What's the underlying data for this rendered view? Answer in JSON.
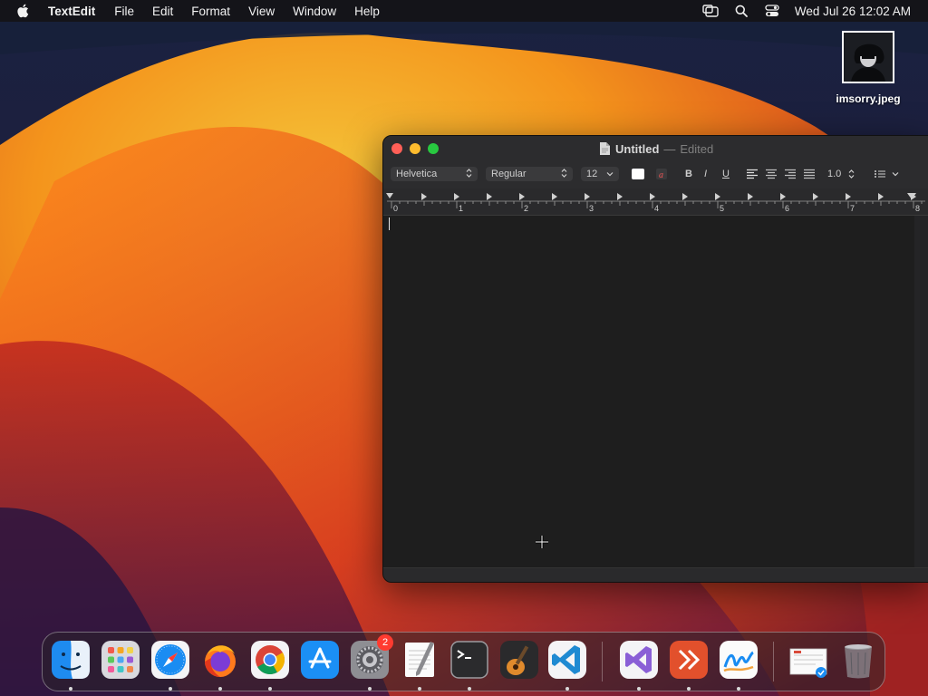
{
  "menubar": {
    "app_name": "TextEdit",
    "menus": [
      "File",
      "Edit",
      "Format",
      "View",
      "Window",
      "Help"
    ],
    "clock": "Wed Jul 26  12:02 AM"
  },
  "desktop_file": {
    "name": "imsorry.jpeg"
  },
  "window": {
    "title": "Untitled",
    "separator": "—",
    "status": "Edited",
    "toolbar": {
      "font_family": "Helvetica",
      "font_style": "Regular",
      "font_size": "12",
      "bold": "B",
      "italic": "I",
      "underline": "U",
      "line_spacing": "1.0"
    },
    "ruler": {
      "labels": [
        "0",
        "1",
        "2",
        "3",
        "4",
        "5",
        "6",
        "7",
        "8"
      ]
    }
  },
  "dock": {
    "items": [
      {
        "name": "finder",
        "running": true
      },
      {
        "name": "launchpad",
        "running": false
      },
      {
        "name": "safari",
        "running": true
      },
      {
        "name": "firefox",
        "running": true
      },
      {
        "name": "chrome",
        "running": true
      },
      {
        "name": "app-store",
        "running": false
      },
      {
        "name": "system-settings",
        "running": true,
        "badge": "2"
      },
      {
        "name": "textedit",
        "running": true
      },
      {
        "name": "terminal",
        "running": true
      },
      {
        "name": "garageband",
        "running": false
      },
      {
        "name": "vscode",
        "running": true
      },
      {
        "name": "visual-studio",
        "running": true
      },
      {
        "name": "remote-desktop",
        "running": true
      },
      {
        "name": "freeform",
        "running": true
      },
      {
        "name": "preview-document",
        "running": false
      },
      {
        "name": "trash",
        "running": false
      }
    ]
  },
  "colors": {
    "close": "#ff5f57",
    "minimize": "#febc2e",
    "zoom": "#28c840",
    "badge": "#ff3b30"
  }
}
